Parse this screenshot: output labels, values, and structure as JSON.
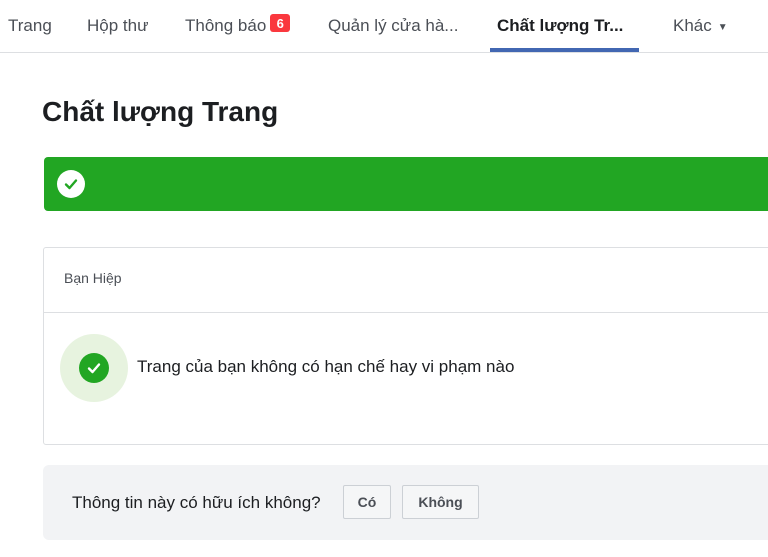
{
  "tabs": [
    {
      "label": "Trang"
    },
    {
      "label": "Hộp thư"
    },
    {
      "label": "Thông báo",
      "badge": "6"
    },
    {
      "label": "Quản lý cửa hà..."
    },
    {
      "label": "Chất lượng Tr...",
      "active": true
    },
    {
      "label": "Khác",
      "icon": "caret-down-icon"
    }
  ],
  "page": {
    "title": "Chất lượng Trang"
  },
  "status": {
    "icon": "check-circle-icon",
    "color": "#22a623"
  },
  "card": {
    "header_label": "Bạn Hiệp",
    "result_icon": "check-circle-icon",
    "result_text": "Trang của bạn không có hạn chế hay vi phạm nào"
  },
  "feedback": {
    "question": "Thông tin này có hữu ích không?",
    "yes_label": "Có",
    "no_label": "Không"
  },
  "colors": {
    "accent": "#4267b2",
    "success": "#22a623",
    "badge": "#fa383e"
  }
}
